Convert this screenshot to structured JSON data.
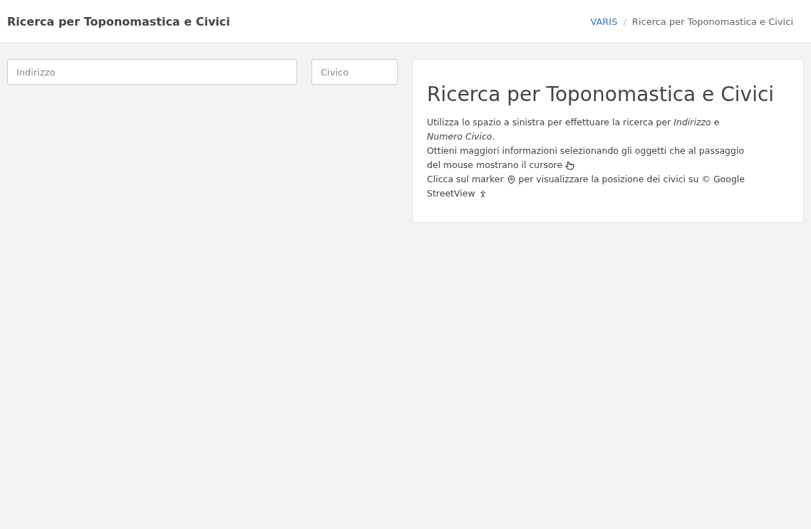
{
  "header": {
    "title": "Ricerca per Toponomastica e Civici",
    "breadcrumb": [
      {
        "label": "VARIS",
        "link": true
      },
      {
        "label": "Ricerca per Toponomastica e Civici",
        "link": false
      }
    ],
    "separator": "/"
  },
  "search": {
    "address": {
      "placeholder": "Indirizzo"
    },
    "number": {
      "placeholder": "Civico"
    }
  },
  "info_card": {
    "title": "Ricerca per Toponomastica e Civici",
    "lines": [
      [
        {
          "kind": "text",
          "text": "Utilizza lo spazio a sinistra per effettuare la ricerca per *Indirizzo* e"
        }
      ],
      [
        {
          "kind": "text",
          "text": "*Numero Civico*."
        }
      ],
      [
        {
          "kind": "text",
          "text": "Ottieni maggiori informazioni selezionando gli oggetti che al passaggio"
        }
      ],
      [
        {
          "kind": "text",
          "text": "del mouse mostrano il cursore"
        },
        {
          "kind": "hand"
        }
      ],
      [
        {
          "kind": "text",
          "text": "Clicca sul marker"
        },
        {
          "kind": "pin"
        },
        {
          "kind": "text",
          "text": "per visualizzare la posizione dei civici su © Google"
        }
      ],
      [
        {
          "kind": "text",
          "text": "StreetView"
        },
        {
          "kind": "person"
        }
      ]
    ]
  }
}
